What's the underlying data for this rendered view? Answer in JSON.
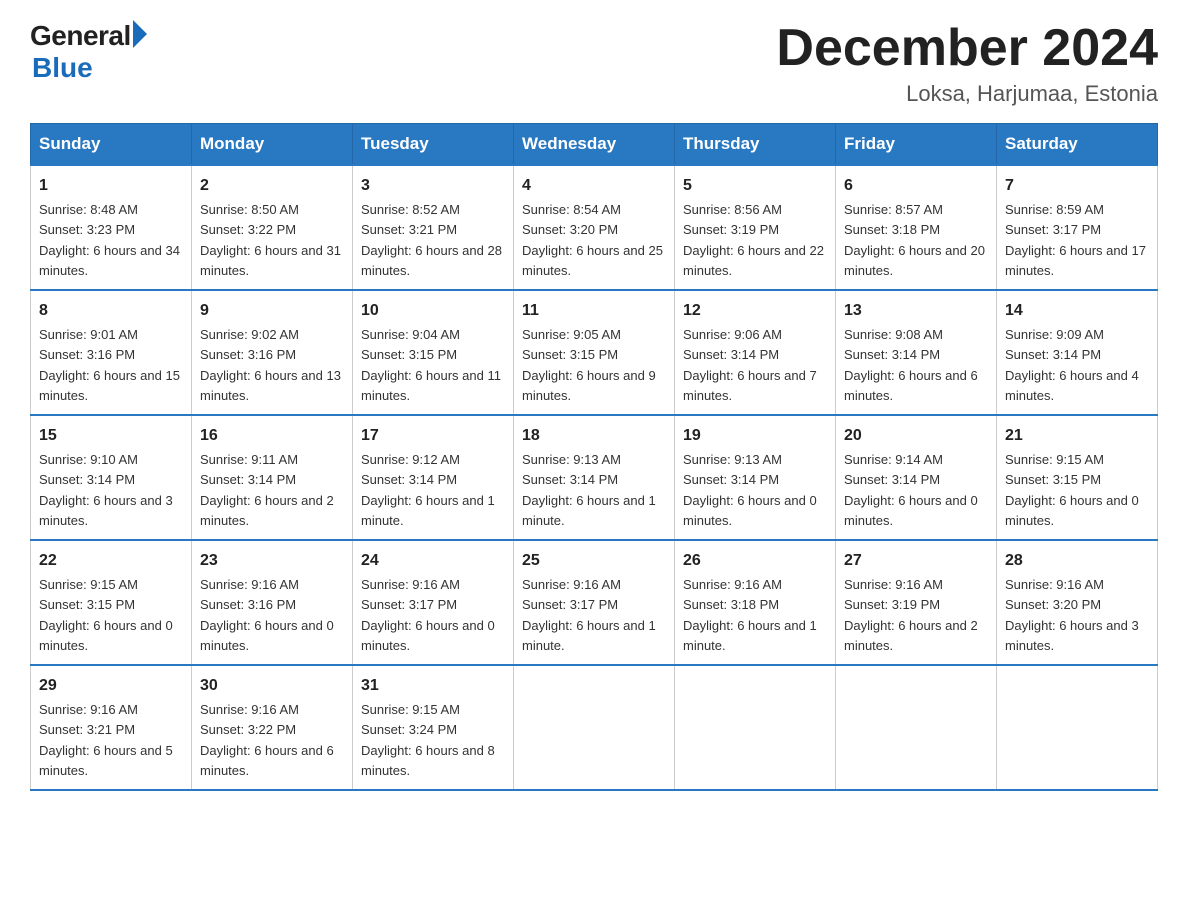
{
  "logo": {
    "general": "General",
    "blue": "Blue"
  },
  "title": "December 2024",
  "location": "Loksa, Harjumaa, Estonia",
  "days_of_week": [
    "Sunday",
    "Monday",
    "Tuesday",
    "Wednesday",
    "Thursday",
    "Friday",
    "Saturday"
  ],
  "weeks": [
    [
      {
        "day": "1",
        "sunrise": "8:48 AM",
        "sunset": "3:23 PM",
        "daylight": "6 hours and 34 minutes."
      },
      {
        "day": "2",
        "sunrise": "8:50 AM",
        "sunset": "3:22 PM",
        "daylight": "6 hours and 31 minutes."
      },
      {
        "day": "3",
        "sunrise": "8:52 AM",
        "sunset": "3:21 PM",
        "daylight": "6 hours and 28 minutes."
      },
      {
        "day": "4",
        "sunrise": "8:54 AM",
        "sunset": "3:20 PM",
        "daylight": "6 hours and 25 minutes."
      },
      {
        "day": "5",
        "sunrise": "8:56 AM",
        "sunset": "3:19 PM",
        "daylight": "6 hours and 22 minutes."
      },
      {
        "day": "6",
        "sunrise": "8:57 AM",
        "sunset": "3:18 PM",
        "daylight": "6 hours and 20 minutes."
      },
      {
        "day": "7",
        "sunrise": "8:59 AM",
        "sunset": "3:17 PM",
        "daylight": "6 hours and 17 minutes."
      }
    ],
    [
      {
        "day": "8",
        "sunrise": "9:01 AM",
        "sunset": "3:16 PM",
        "daylight": "6 hours and 15 minutes."
      },
      {
        "day": "9",
        "sunrise": "9:02 AM",
        "sunset": "3:16 PM",
        "daylight": "6 hours and 13 minutes."
      },
      {
        "day": "10",
        "sunrise": "9:04 AM",
        "sunset": "3:15 PM",
        "daylight": "6 hours and 11 minutes."
      },
      {
        "day": "11",
        "sunrise": "9:05 AM",
        "sunset": "3:15 PM",
        "daylight": "6 hours and 9 minutes."
      },
      {
        "day": "12",
        "sunrise": "9:06 AM",
        "sunset": "3:14 PM",
        "daylight": "6 hours and 7 minutes."
      },
      {
        "day": "13",
        "sunrise": "9:08 AM",
        "sunset": "3:14 PM",
        "daylight": "6 hours and 6 minutes."
      },
      {
        "day": "14",
        "sunrise": "9:09 AM",
        "sunset": "3:14 PM",
        "daylight": "6 hours and 4 minutes."
      }
    ],
    [
      {
        "day": "15",
        "sunrise": "9:10 AM",
        "sunset": "3:14 PM",
        "daylight": "6 hours and 3 minutes."
      },
      {
        "day": "16",
        "sunrise": "9:11 AM",
        "sunset": "3:14 PM",
        "daylight": "6 hours and 2 minutes."
      },
      {
        "day": "17",
        "sunrise": "9:12 AM",
        "sunset": "3:14 PM",
        "daylight": "6 hours and 1 minute."
      },
      {
        "day": "18",
        "sunrise": "9:13 AM",
        "sunset": "3:14 PM",
        "daylight": "6 hours and 1 minute."
      },
      {
        "day": "19",
        "sunrise": "9:13 AM",
        "sunset": "3:14 PM",
        "daylight": "6 hours and 0 minutes."
      },
      {
        "day": "20",
        "sunrise": "9:14 AM",
        "sunset": "3:14 PM",
        "daylight": "6 hours and 0 minutes."
      },
      {
        "day": "21",
        "sunrise": "9:15 AM",
        "sunset": "3:15 PM",
        "daylight": "6 hours and 0 minutes."
      }
    ],
    [
      {
        "day": "22",
        "sunrise": "9:15 AM",
        "sunset": "3:15 PM",
        "daylight": "6 hours and 0 minutes."
      },
      {
        "day": "23",
        "sunrise": "9:16 AM",
        "sunset": "3:16 PM",
        "daylight": "6 hours and 0 minutes."
      },
      {
        "day": "24",
        "sunrise": "9:16 AM",
        "sunset": "3:17 PM",
        "daylight": "6 hours and 0 minutes."
      },
      {
        "day": "25",
        "sunrise": "9:16 AM",
        "sunset": "3:17 PM",
        "daylight": "6 hours and 1 minute."
      },
      {
        "day": "26",
        "sunrise": "9:16 AM",
        "sunset": "3:18 PM",
        "daylight": "6 hours and 1 minute."
      },
      {
        "day": "27",
        "sunrise": "9:16 AM",
        "sunset": "3:19 PM",
        "daylight": "6 hours and 2 minutes."
      },
      {
        "day": "28",
        "sunrise": "9:16 AM",
        "sunset": "3:20 PM",
        "daylight": "6 hours and 3 minutes."
      }
    ],
    [
      {
        "day": "29",
        "sunrise": "9:16 AM",
        "sunset": "3:21 PM",
        "daylight": "6 hours and 5 minutes."
      },
      {
        "day": "30",
        "sunrise": "9:16 AM",
        "sunset": "3:22 PM",
        "daylight": "6 hours and 6 minutes."
      },
      {
        "day": "31",
        "sunrise": "9:15 AM",
        "sunset": "3:24 PM",
        "daylight": "6 hours and 8 minutes."
      },
      null,
      null,
      null,
      null
    ]
  ]
}
